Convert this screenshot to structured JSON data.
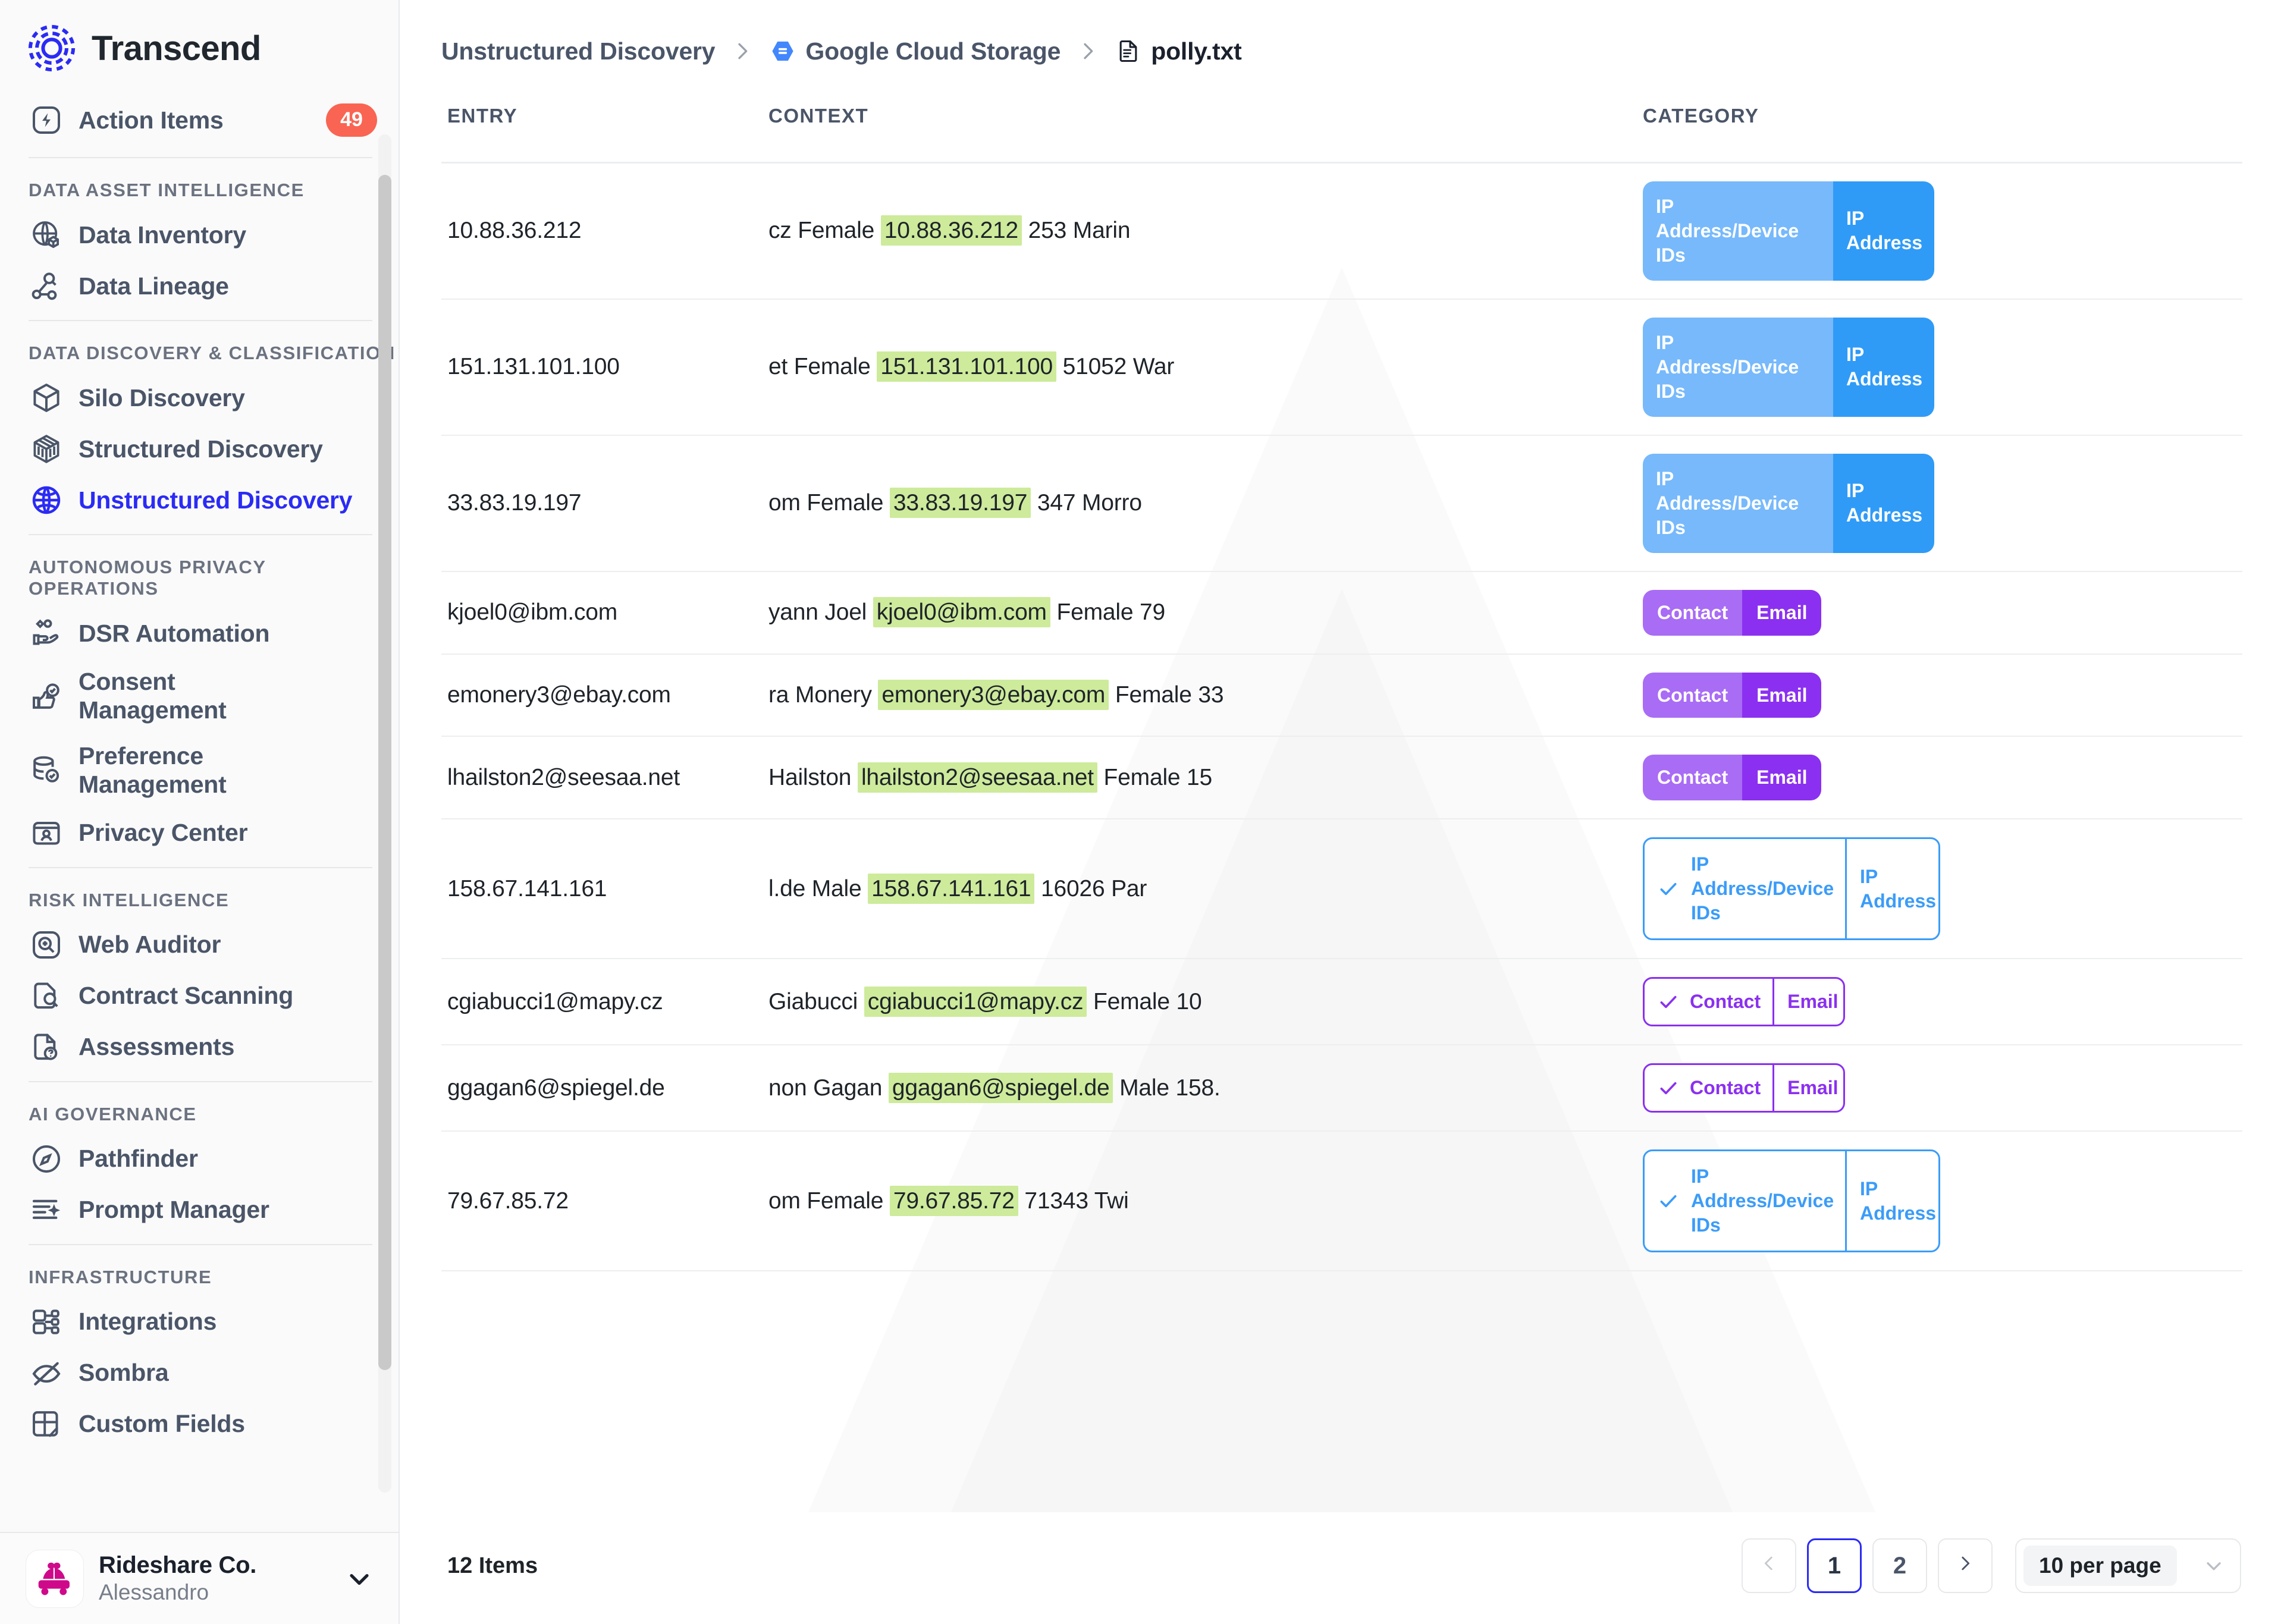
{
  "brand": {
    "name": "Transcend"
  },
  "sidebar": {
    "top_item": {
      "label": "Action Items",
      "badge": "49",
      "icon": "bolt-icon"
    },
    "sections": [
      {
        "title": "DATA ASSET INTELLIGENCE",
        "items": [
          {
            "label": "Data Inventory",
            "icon": "globe-box-icon",
            "active": false
          },
          {
            "label": "Data Lineage",
            "icon": "lineage-icon",
            "active": false
          }
        ]
      },
      {
        "title": "DATA DISCOVERY & CLASSIFICATION",
        "items": [
          {
            "label": "Silo Discovery",
            "icon": "cube-icon",
            "active": false
          },
          {
            "label": "Structured Discovery",
            "icon": "grid-cube-icon",
            "active": false
          },
          {
            "label": "Unstructured Discovery",
            "icon": "globe-icon",
            "active": true
          }
        ]
      },
      {
        "title": "AUTONOMOUS PRIVACY OPERATIONS",
        "items": [
          {
            "label": "DSR Automation",
            "icon": "hand-data-icon",
            "active": false
          },
          {
            "label": "Consent\nManagement",
            "icon": "thumbs-up-check-icon",
            "active": false
          },
          {
            "label": "Preference\nManagement",
            "icon": "database-check-icon",
            "active": false
          },
          {
            "label": "Privacy Center",
            "icon": "id-card-icon",
            "active": false
          }
        ]
      },
      {
        "title": "RISK INTELLIGENCE",
        "items": [
          {
            "label": "Web Auditor",
            "icon": "magnifier-plus-icon",
            "active": false
          },
          {
            "label": "Contract Scanning",
            "icon": "document-search-icon",
            "active": false
          },
          {
            "label": "Assessments",
            "icon": "document-question-icon",
            "active": false
          }
        ]
      },
      {
        "title": "AI GOVERNANCE",
        "items": [
          {
            "label": "Pathfinder",
            "icon": "compass-icon",
            "active": false
          },
          {
            "label": "Prompt Manager",
            "icon": "prompt-sparkle-icon",
            "active": false
          }
        ]
      },
      {
        "title": "INFRASTRUCTURE",
        "items": [
          {
            "label": "Integrations",
            "icon": "integrations-icon",
            "active": false
          },
          {
            "label": "Sombra",
            "icon": "eye-off-icon",
            "active": false
          },
          {
            "label": "Custom Fields",
            "icon": "custom-fields-icon",
            "active": false
          }
        ]
      }
    ],
    "footer": {
      "org": "Rideshare Co.",
      "user": "Alessandro",
      "avatar_icon": "rideshare-car-icon",
      "chevron_icon": "chevron-down-icon"
    }
  },
  "breadcrumb": {
    "items": [
      {
        "label": "Unstructured Discovery",
        "icon": null,
        "current": false
      },
      {
        "label": "Google Cloud Storage",
        "icon": "google-cloud-storage-icon",
        "current": false
      },
      {
        "label": "polly.txt",
        "icon": "text-file-icon",
        "current": true
      }
    ],
    "separator_icon": "chevron-right-icon"
  },
  "table": {
    "columns": [
      "ENTRY",
      "CONTEXT",
      "CATEGORY"
    ],
    "rows": [
      {
        "entry": "10.88.36.212",
        "context_pre": "cz Female ",
        "context_hl": "10.88.36.212",
        "context_post": " 253 Marin",
        "pill_style": "solid-blue",
        "pill_a": "IP Address/Device IDs",
        "pill_b": "IP Address",
        "checked": false
      },
      {
        "entry": "151.131.101.100",
        "context_pre": "et Female ",
        "context_hl": "151.131.101.100",
        "context_post": " 51052 War",
        "pill_style": "solid-blue",
        "pill_a": "IP Address/Device IDs",
        "pill_b": "IP Address",
        "checked": false
      },
      {
        "entry": "33.83.19.197",
        "context_pre": "om Female ",
        "context_hl": "33.83.19.197",
        "context_post": " 347 Morro",
        "pill_style": "solid-blue",
        "pill_a": "IP Address/Device IDs",
        "pill_b": "IP Address",
        "checked": false
      },
      {
        "entry": "kjoel0@ibm.com",
        "context_pre": "yann Joel ",
        "context_hl": "kjoel0@ibm.com",
        "context_post": " Female 79",
        "pill_style": "solid-purple",
        "pill_a": "Contact",
        "pill_b": "Email",
        "checked": false
      },
      {
        "entry": "emonery3@ebay.com",
        "context_pre": "ra Monery ",
        "context_hl": "emonery3@ebay.com",
        "context_post": " Female 33",
        "pill_style": "solid-purple",
        "pill_a": "Contact",
        "pill_b": "Email",
        "checked": false
      },
      {
        "entry": "lhailston2@seesaa.net",
        "context_pre": "Hailston ",
        "context_hl": "lhailston2@seesaa.net",
        "context_post": " Female 15",
        "pill_style": "solid-purple",
        "pill_a": "Contact",
        "pill_b": "Email",
        "checked": false
      },
      {
        "entry": "158.67.141.161",
        "context_pre": "l.de Male ",
        "context_hl": "158.67.141.161",
        "context_post": " 16026 Par",
        "pill_style": "outline-blue",
        "pill_a": "IP Address/Device IDs",
        "pill_b": "IP Address",
        "checked": true
      },
      {
        "entry": "cgiabucci1@mapy.cz",
        "context_pre": "Giabucci ",
        "context_hl": "cgiabucci1@mapy.cz",
        "context_post": " Female 10",
        "pill_style": "outline-purple",
        "pill_a": "Contact",
        "pill_b": "Email",
        "checked": true
      },
      {
        "entry": "ggagan6@spiegel.de",
        "context_pre": "non Gagan ",
        "context_hl": "ggagan6@spiegel.de",
        "context_post": " Male 158.",
        "pill_style": "outline-purple",
        "pill_a": "Contact",
        "pill_b": "Email",
        "checked": true
      },
      {
        "entry": "79.67.85.72",
        "context_pre": "om Female ",
        "context_hl": "79.67.85.72",
        "context_post": " 71343 Twi",
        "pill_style": "outline-blue",
        "pill_a": "IP Address/Device IDs",
        "pill_b": "IP Address",
        "checked": true
      }
    ]
  },
  "footer": {
    "items_count": "12 Items",
    "pages": [
      "1",
      "2"
    ],
    "current_page": "1",
    "prev_icon": "chevron-left-icon",
    "next_icon": "chevron-right-icon",
    "per_page": "10 per page",
    "per_page_chevron": "chevron-down-icon"
  },
  "colors": {
    "accent": "#2b2bf5",
    "badge": "#f96552",
    "highlight": "#cdeb9b",
    "pill_blue_light": "#77b9fb",
    "pill_blue": "#2f9bf7",
    "pill_purple_light": "#a96cf5",
    "pill_purple": "#8b30f0",
    "avatar_pink": "#cf0a8a"
  }
}
